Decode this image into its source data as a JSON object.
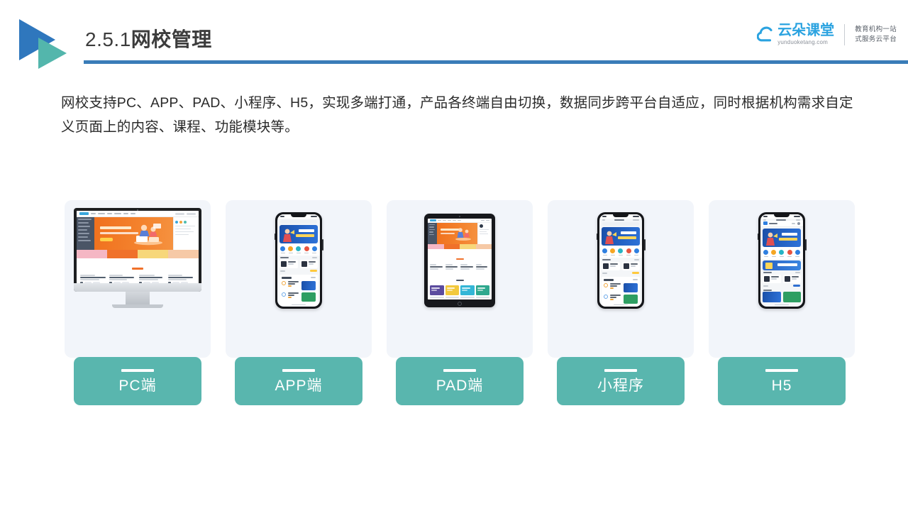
{
  "header": {
    "title_number": "2.5.1",
    "title_name": "网校管理",
    "logo_icon": "double-triangle-logo",
    "rule_color": "#3a7cb8"
  },
  "brand": {
    "icon": "cloud-icon",
    "name_cn": "云朵课堂",
    "name_en": "yunduoketang.com",
    "tagline_line1": "教育机构一站",
    "tagline_line2": "式服务云平台",
    "accent_color": "#2ba3e0"
  },
  "body": {
    "paragraph": "网校支持PC、APP、PAD、小程序、H5，实现多端打通，产品各终端自由切换，数据同步跨平台自适应，同时根据机构需求自定义页面上的内容、课程、功能模块等。"
  },
  "cards": {
    "label_bg_color": "#59b6ae",
    "card_bg_color": "#f2f5fa",
    "items": [
      {
        "label": "PC端",
        "device": "desktop-monitor-mockup"
      },
      {
        "label": "APP端",
        "device": "smartphone-mockup"
      },
      {
        "label": "PAD端",
        "device": "tablet-mockup"
      },
      {
        "label": "小程序",
        "device": "smartphone-mockup"
      },
      {
        "label": "H5",
        "device": "smartphone-mockup"
      }
    ]
  }
}
